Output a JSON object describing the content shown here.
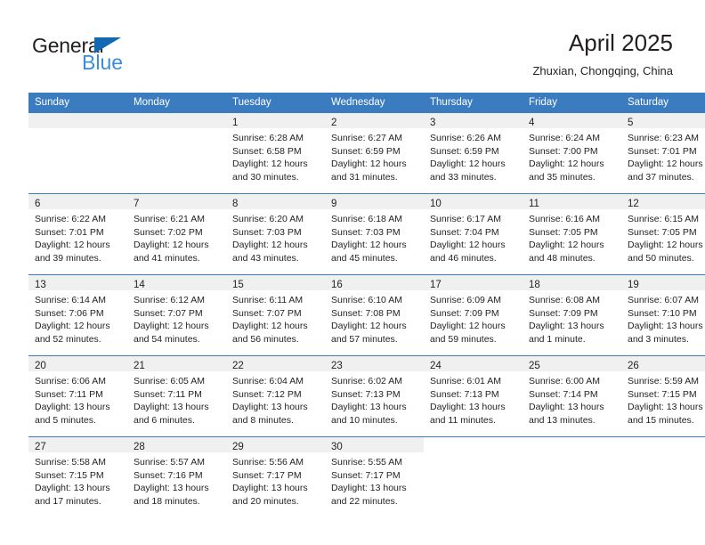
{
  "brand": {
    "name_part1": "General",
    "name_part2": "Blue",
    "flag_icon": "triangle-flag-icon",
    "color_dark": "#231f20",
    "color_blue": "#3a8dd8",
    "color_flag": "#1368b3"
  },
  "header": {
    "title": "April 2025",
    "subtitle": "Zhuxian, Chongqing, China"
  },
  "theme": {
    "header_blue": "#3b7cc0",
    "daynum_band": "#f0f0f0",
    "text": "#231f20"
  },
  "calendar": {
    "weekday_headers": [
      "Sunday",
      "Monday",
      "Tuesday",
      "Wednesday",
      "Thursday",
      "Friday",
      "Saturday"
    ],
    "weeks": [
      [
        {
          "day": "",
          "lines": []
        },
        {
          "day": "",
          "lines": []
        },
        {
          "day": "1",
          "lines": [
            "Sunrise: 6:28 AM",
            "Sunset: 6:58 PM",
            "Daylight: 12 hours",
            "and 30 minutes."
          ]
        },
        {
          "day": "2",
          "lines": [
            "Sunrise: 6:27 AM",
            "Sunset: 6:59 PM",
            "Daylight: 12 hours",
            "and 31 minutes."
          ]
        },
        {
          "day": "3",
          "lines": [
            "Sunrise: 6:26 AM",
            "Sunset: 6:59 PM",
            "Daylight: 12 hours",
            "and 33 minutes."
          ]
        },
        {
          "day": "4",
          "lines": [
            "Sunrise: 6:24 AM",
            "Sunset: 7:00 PM",
            "Daylight: 12 hours",
            "and 35 minutes."
          ]
        },
        {
          "day": "5",
          "lines": [
            "Sunrise: 6:23 AM",
            "Sunset: 7:01 PM",
            "Daylight: 12 hours",
            "and 37 minutes."
          ]
        }
      ],
      [
        {
          "day": "6",
          "lines": [
            "Sunrise: 6:22 AM",
            "Sunset: 7:01 PM",
            "Daylight: 12 hours",
            "and 39 minutes."
          ]
        },
        {
          "day": "7",
          "lines": [
            "Sunrise: 6:21 AM",
            "Sunset: 7:02 PM",
            "Daylight: 12 hours",
            "and 41 minutes."
          ]
        },
        {
          "day": "8",
          "lines": [
            "Sunrise: 6:20 AM",
            "Sunset: 7:03 PM",
            "Daylight: 12 hours",
            "and 43 minutes."
          ]
        },
        {
          "day": "9",
          "lines": [
            "Sunrise: 6:18 AM",
            "Sunset: 7:03 PM",
            "Daylight: 12 hours",
            "and 45 minutes."
          ]
        },
        {
          "day": "10",
          "lines": [
            "Sunrise: 6:17 AM",
            "Sunset: 7:04 PM",
            "Daylight: 12 hours",
            "and 46 minutes."
          ]
        },
        {
          "day": "11",
          "lines": [
            "Sunrise: 6:16 AM",
            "Sunset: 7:05 PM",
            "Daylight: 12 hours",
            "and 48 minutes."
          ]
        },
        {
          "day": "12",
          "lines": [
            "Sunrise: 6:15 AM",
            "Sunset: 7:05 PM",
            "Daylight: 12 hours",
            "and 50 minutes."
          ]
        }
      ],
      [
        {
          "day": "13",
          "lines": [
            "Sunrise: 6:14 AM",
            "Sunset: 7:06 PM",
            "Daylight: 12 hours",
            "and 52 minutes."
          ]
        },
        {
          "day": "14",
          "lines": [
            "Sunrise: 6:12 AM",
            "Sunset: 7:07 PM",
            "Daylight: 12 hours",
            "and 54 minutes."
          ]
        },
        {
          "day": "15",
          "lines": [
            "Sunrise: 6:11 AM",
            "Sunset: 7:07 PM",
            "Daylight: 12 hours",
            "and 56 minutes."
          ]
        },
        {
          "day": "16",
          "lines": [
            "Sunrise: 6:10 AM",
            "Sunset: 7:08 PM",
            "Daylight: 12 hours",
            "and 57 minutes."
          ]
        },
        {
          "day": "17",
          "lines": [
            "Sunrise: 6:09 AM",
            "Sunset: 7:09 PM",
            "Daylight: 12 hours",
            "and 59 minutes."
          ]
        },
        {
          "day": "18",
          "lines": [
            "Sunrise: 6:08 AM",
            "Sunset: 7:09 PM",
            "Daylight: 13 hours",
            "and 1 minute."
          ]
        },
        {
          "day": "19",
          "lines": [
            "Sunrise: 6:07 AM",
            "Sunset: 7:10 PM",
            "Daylight: 13 hours",
            "and 3 minutes."
          ]
        }
      ],
      [
        {
          "day": "20",
          "lines": [
            "Sunrise: 6:06 AM",
            "Sunset: 7:11 PM",
            "Daylight: 13 hours",
            "and 5 minutes."
          ]
        },
        {
          "day": "21",
          "lines": [
            "Sunrise: 6:05 AM",
            "Sunset: 7:11 PM",
            "Daylight: 13 hours",
            "and 6 minutes."
          ]
        },
        {
          "day": "22",
          "lines": [
            "Sunrise: 6:04 AM",
            "Sunset: 7:12 PM",
            "Daylight: 13 hours",
            "and 8 minutes."
          ]
        },
        {
          "day": "23",
          "lines": [
            "Sunrise: 6:02 AM",
            "Sunset: 7:13 PM",
            "Daylight: 13 hours",
            "and 10 minutes."
          ]
        },
        {
          "day": "24",
          "lines": [
            "Sunrise: 6:01 AM",
            "Sunset: 7:13 PM",
            "Daylight: 13 hours",
            "and 11 minutes."
          ]
        },
        {
          "day": "25",
          "lines": [
            "Sunrise: 6:00 AM",
            "Sunset: 7:14 PM",
            "Daylight: 13 hours",
            "and 13 minutes."
          ]
        },
        {
          "day": "26",
          "lines": [
            "Sunrise: 5:59 AM",
            "Sunset: 7:15 PM",
            "Daylight: 13 hours",
            "and 15 minutes."
          ]
        }
      ],
      [
        {
          "day": "27",
          "lines": [
            "Sunrise: 5:58 AM",
            "Sunset: 7:15 PM",
            "Daylight: 13 hours",
            "and 17 minutes."
          ]
        },
        {
          "day": "28",
          "lines": [
            "Sunrise: 5:57 AM",
            "Sunset: 7:16 PM",
            "Daylight: 13 hours",
            "and 18 minutes."
          ]
        },
        {
          "day": "29",
          "lines": [
            "Sunrise: 5:56 AM",
            "Sunset: 7:17 PM",
            "Daylight: 13 hours",
            "and 20 minutes."
          ]
        },
        {
          "day": "30",
          "lines": [
            "Sunrise: 5:55 AM",
            "Sunset: 7:17 PM",
            "Daylight: 13 hours",
            "and 22 minutes."
          ]
        },
        {
          "day": "",
          "lines": []
        },
        {
          "day": "",
          "lines": []
        },
        {
          "day": "",
          "lines": []
        }
      ]
    ]
  }
}
